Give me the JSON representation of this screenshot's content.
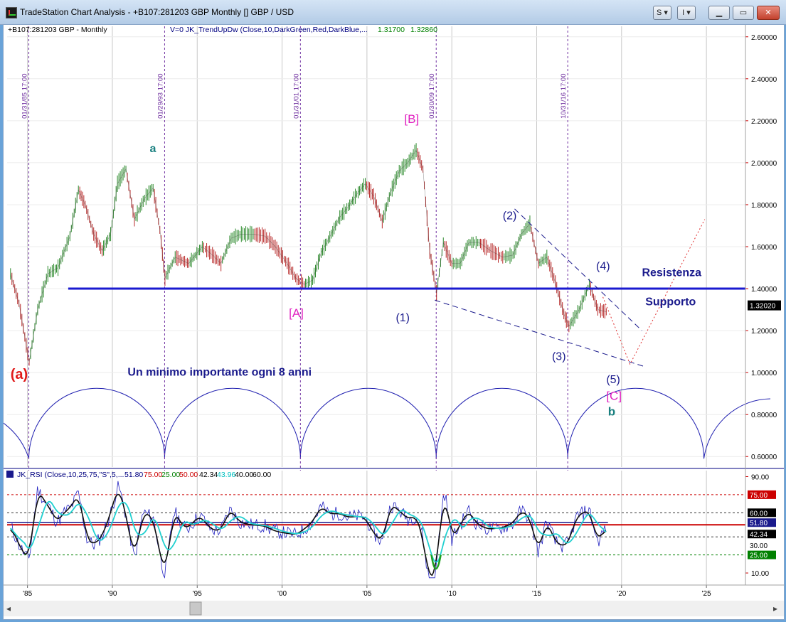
{
  "window": {
    "title": "TradeStation Chart Analysis - +B107:281203 GBP Monthly [] GBP / USD",
    "btn_s": "S",
    "btn_i": "I"
  },
  "header": {
    "symbol": "+B107:281203 GBP - Monthly",
    "indicator": "V=0   JK_TrendUpDw  (Close,10,DarkGreen,Red,DarkBlue,...",
    "value1": "1.31700",
    "value2": "1.32860"
  },
  "rsi_header": {
    "text": "JK_RSI (Close,10,25,75,\"S\",5,...",
    "values": [
      "51.80",
      "75.00",
      "25.00",
      "50.00",
      "42.34",
      "43.96",
      "40.00",
      "60.00"
    ],
    "colors": [
      "#000080",
      "#cc0000",
      "#008000",
      "#cc0000",
      "#000000",
      "#00c0c0",
      "#000000",
      "#000000"
    ]
  },
  "cycle_dates": [
    "01/31/85 17:00",
    "01/29/93 17:00",
    "01/31/01 17:00",
    "01/30/09 17:00",
    "10/31/16 17:00"
  ],
  "annotations": {
    "a_red": "(a)",
    "a_teal": "a",
    "B": "[B]",
    "A": "[A]",
    "w1": "(1)",
    "w2": "(2)",
    "w3": "(3)",
    "w4": "(4)",
    "w5": "(5)",
    "C": "[C]",
    "b": "b",
    "resistenza": "Resistenza",
    "supporto": "Supporto",
    "cycle_note": "Un minimo importante ogni 8 anni"
  },
  "price_tag": "1.32020",
  "rsi_tags": [
    {
      "text": "75.00",
      "value": 75,
      "bg": "#cc0000",
      "fg": "#ffffff"
    },
    {
      "text": "60.00",
      "value": 60,
      "bg": "#000000",
      "fg": "#ffffff"
    },
    {
      "text": "51.80",
      "value": 51.8,
      "bg": "#1a1a8c",
      "fg": "#ffffff"
    },
    {
      "text": "42.34",
      "value": 42.34,
      "bg": "#000000",
      "fg": "#ffffff"
    },
    {
      "text": "30.00",
      "value": 33,
      "bg": "#ffffff",
      "fg": "#000000"
    },
    {
      "text": "25.00",
      "value": 25,
      "bg": "#008000",
      "fg": "#ffffff"
    }
  ],
  "chart_data": {
    "type": "line",
    "title": "",
    "price_axis": {
      "ylim": [
        0.55,
        2.65
      ],
      "ticks": [
        "2.60000",
        "2.40000",
        "2.20000",
        "2.00000",
        "1.80000",
        "1.60000",
        "1.40000",
        "1.20000",
        "1.00000",
        "0.80000",
        "0.60000"
      ]
    },
    "rsi_axis": {
      "ylim": [
        0,
        95
      ],
      "ticks": [
        "90.00",
        "10.00"
      ],
      "levels": [
        75,
        60,
        50,
        40,
        25
      ]
    },
    "x_axis": {
      "xlim": [
        1983.8,
        2027.3
      ],
      "ticks": [
        "'85",
        "'90",
        "'95",
        "'00",
        "'05",
        "'10",
        "'15",
        "'20",
        "'25"
      ]
    },
    "series": [
      {
        "name": "GBP/USD",
        "x": [
          1984.0,
          1984.5,
          1985.1,
          1985.6,
          1986.2,
          1986.8,
          1987.5,
          1988.0,
          1988.4,
          1988.9,
          1989.4,
          1989.9,
          1990.3,
          1990.8,
          1991.3,
          1991.9,
          1992.4,
          1992.8,
          1993.1,
          1993.7,
          1994.5,
          1995.3,
          1995.9,
          1996.4,
          1997.0,
          1997.6,
          1998.3,
          1999.0,
          1999.6,
          2000.3,
          2000.8,
          2001.3,
          2001.8,
          2002.3,
          2002.9,
          2003.4,
          2003.9,
          2004.4,
          2004.9,
          2005.4,
          2005.9,
          2006.4,
          2006.9,
          2007.4,
          2007.9,
          2008.3,
          2008.7,
          2009.1,
          2009.5,
          2010.0,
          2010.5,
          2011.0,
          2011.6,
          2012.3,
          2013.0,
          2013.6,
          2014.1,
          2014.6,
          2015.1,
          2015.6,
          2016.1,
          2016.6,
          2016.9,
          2017.5,
          2018.1,
          2018.6,
          2019.1
        ],
        "values": [
          1.47,
          1.33,
          1.05,
          1.3,
          1.47,
          1.5,
          1.65,
          1.87,
          1.8,
          1.66,
          1.58,
          1.66,
          1.9,
          1.97,
          1.73,
          1.83,
          1.88,
          1.68,
          1.45,
          1.55,
          1.52,
          1.6,
          1.56,
          1.52,
          1.64,
          1.66,
          1.66,
          1.65,
          1.6,
          1.52,
          1.45,
          1.42,
          1.44,
          1.57,
          1.66,
          1.74,
          1.79,
          1.85,
          1.9,
          1.84,
          1.72,
          1.86,
          1.96,
          2.0,
          2.06,
          1.97,
          1.58,
          1.38,
          1.62,
          1.52,
          1.52,
          1.62,
          1.62,
          1.58,
          1.55,
          1.56,
          1.66,
          1.71,
          1.52,
          1.55,
          1.43,
          1.28,
          1.22,
          1.3,
          1.42,
          1.3,
          1.29
        ]
      }
    ],
    "levels": [
      {
        "name": "Resistenza / Supporto",
        "value": 1.4
      }
    ],
    "cycle_lows": [
      1985.08,
      1993.08,
      2001.08,
      2009.08,
      2016.83,
      2024.85
    ]
  }
}
